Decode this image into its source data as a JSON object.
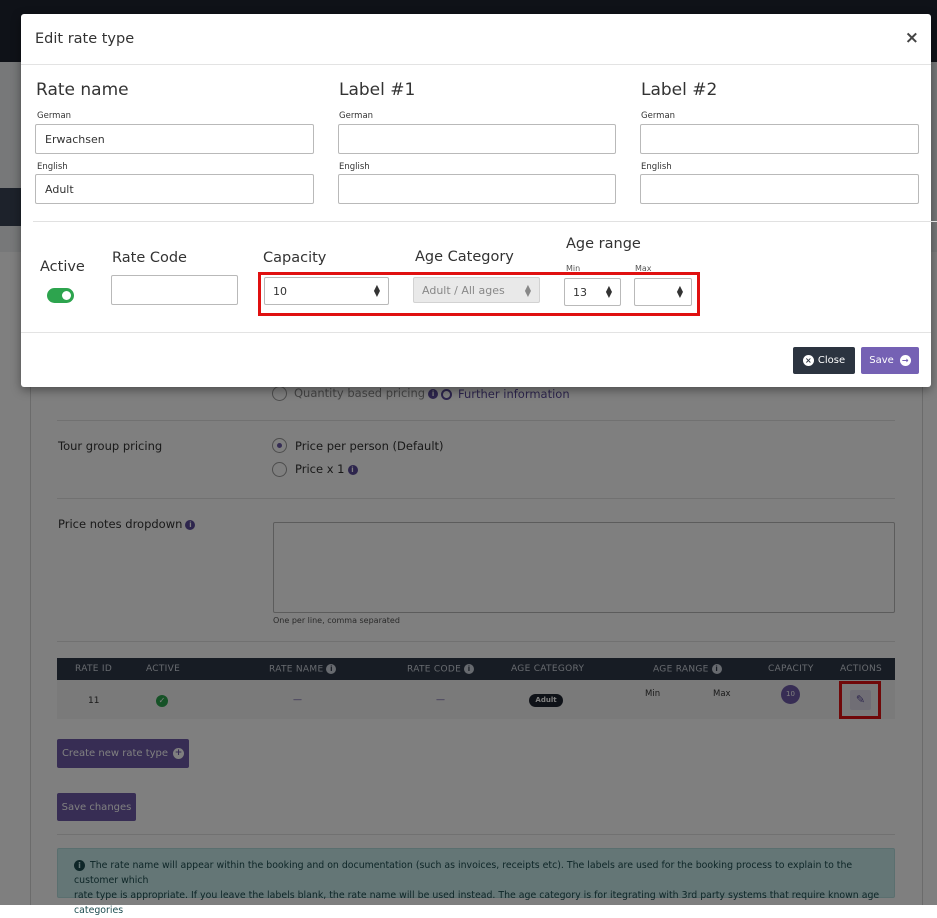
{
  "background": {
    "quantity_pricing_label": "Quantity based pricing",
    "further_info_link": "Further information",
    "tour_group_pricing_label": "Tour group pricing",
    "tour_options": [
      "Price per person (Default)",
      "Price x 1"
    ],
    "price_notes_label": "Price notes dropdown",
    "price_notes_hint": "One per line, comma separated",
    "table": {
      "headers": [
        "RATE ID",
        "ACTIVE",
        "RATE NAME",
        "RATE CODE",
        "AGE CATEGORY",
        "AGE RANGE",
        "CAPACITY",
        "ACTIONS"
      ],
      "row": {
        "rate_id": "11",
        "rate_name": "—",
        "rate_code": "—",
        "age_category": "Adult",
        "age_min_label": "Min",
        "age_max_label": "Max",
        "capacity": "10"
      }
    },
    "create_button": "Create new rate type",
    "save_changes_button": "Save changes",
    "info_text_line1": "The rate name will appear within the booking and on documentation (such as invoices, receipts etc). The labels are used for the booking process to explain to the customer which",
    "info_text_line2": "rate type is appropriate. If you leave the labels blank, the rate name will be used instead. The age category is for itegrating with 3rd party systems that require known age categories"
  },
  "modal": {
    "title": "Edit rate type",
    "close_symbol": "×",
    "sections": {
      "rate_name": "Rate name",
      "label1": "Label #1",
      "label2": "Label #2"
    },
    "lang_german": "German",
    "lang_english": "English",
    "rate_name_german": "Erwachsen",
    "rate_name_english": "Adult",
    "label1_german": "",
    "label1_english": "",
    "label2_german": "",
    "label2_english": "",
    "active_label": "Active",
    "rate_code_label": "Rate Code",
    "rate_code_value": "",
    "capacity_label": "Capacity",
    "capacity_value": "10",
    "age_category_label": "Age Category",
    "age_category_value": "Adult / All ages",
    "age_range_label": "Age range",
    "age_min_label": "Min",
    "age_max_label": "Max",
    "age_min_value": "13",
    "age_max_value": "",
    "close_button": "Close",
    "save_button": "Save"
  },
  "colors": {
    "accent_purple": "#7561b4",
    "toggle_green": "#2da44e",
    "highlight_red": "#e01010",
    "dark_button": "#2c3440"
  }
}
